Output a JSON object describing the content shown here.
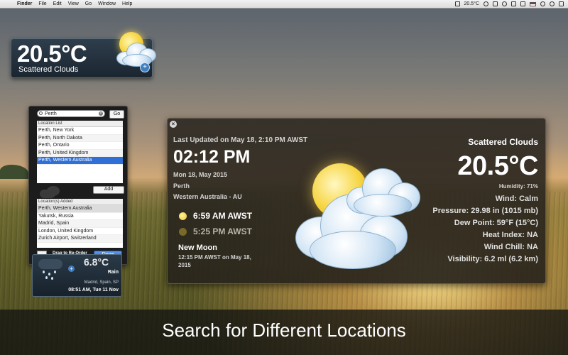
{
  "menubar": {
    "apple_glyph": "",
    "items": [
      "Finder",
      "File",
      "Edit",
      "View",
      "Go",
      "Window",
      "Help"
    ],
    "status_temp": "20.5°C"
  },
  "mini_top": {
    "temp": "20.5°C",
    "condition": "Scattered Clouds",
    "plus": "+"
  },
  "location_panel": {
    "search_value": "Perth",
    "go_label": "Go",
    "list_header": "Location List",
    "results": [
      "Perth, New York",
      "Perth, North Dakota",
      "Perth, Ontario",
      "Perth, United Kingdom",
      "Perth, Western Australia"
    ],
    "selected_index": 4,
    "add_label": "Add",
    "added_header": "Location(s) Added",
    "added": [
      "Perth, Western Australia",
      "Yakutsk, Russia",
      "Madrid, Spain",
      "London, United Kingdom",
      "Zurich Airport, Switzerland"
    ],
    "minus_label": "–",
    "drag_label": "Drag to Re-Order",
    "done_label": "Done"
  },
  "mini_bottom": {
    "temp": "6.8°C",
    "condition": "Rain",
    "location": "Madrid, Spain, SP",
    "time": "08:51 AM, Tue 11 Nov",
    "plus": "+"
  },
  "main": {
    "close": "×",
    "last_updated": "Last Updated on May 18, 2:10 PM AWST",
    "clock": "02:12 PM",
    "date": "Mon 18, May 2015",
    "city": "Perth",
    "region": "Western Australia - AU",
    "sunrise": "6:59 AM AWST",
    "sunset": "5:25 PM AWST",
    "moon_phase": "New Moon",
    "moon_time": "12:15 PM AWST on May 18, 2015",
    "condition": "Scattered Clouds",
    "temp": "20.5°C",
    "humidity": "Humidity: 71%",
    "stats": [
      "Wind: Calm",
      "Pressure: 29.98 in (1015 mb)",
      "Dew Point: 59°F (15°C)",
      "Heat Index: NA",
      "Wind Chill: NA",
      "Visibility: 6.2 ml (6.2 km)"
    ]
  },
  "caption": "Search for Different Locations"
}
